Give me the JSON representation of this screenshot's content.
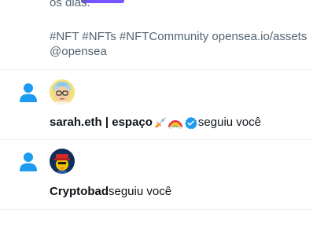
{
  "tweet_cell": {
    "line1": "os dias.",
    "hashtags_line": "#NFT #NFTs #NFTCommunity  opensea.io/assets",
    "mention_line": "@opensea"
  },
  "notifications": [
    {
      "icon": "person-icon",
      "name": "sarah.eth | espaço",
      "emojis": [
        "rocket-emoji",
        "rainbow-emoji"
      ],
      "verified": true,
      "action": "seguiu você"
    },
    {
      "icon": "person-icon",
      "name": "Cryptobad",
      "verified": false,
      "action": "seguiu você"
    }
  ],
  "colors": {
    "accent": "#1d9bf0",
    "purple_tab": "#7856ff",
    "text_secondary": "#536471",
    "text_primary": "#0f1419",
    "divider": "#eff3f4"
  }
}
